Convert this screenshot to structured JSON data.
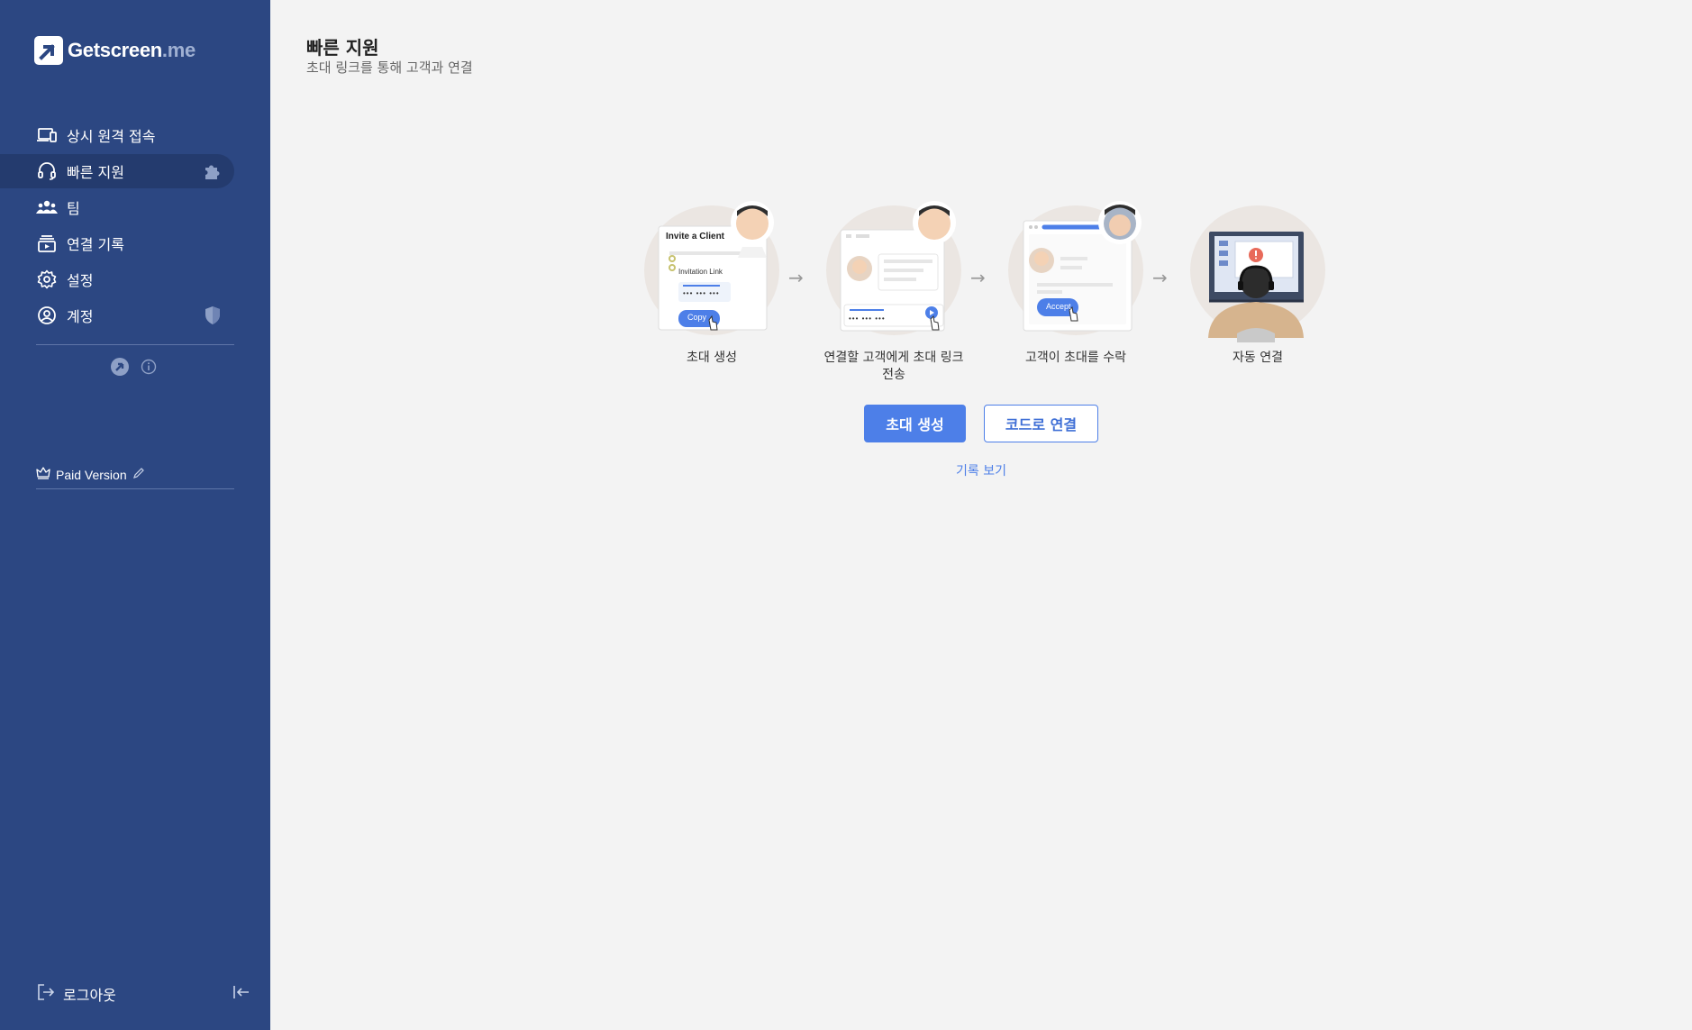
{
  "app": {
    "logo_main": "Getscreen",
    "logo_suffix": ".me"
  },
  "sidebar": {
    "items": [
      {
        "label": "상시 원격 접속",
        "icon": "devices-icon"
      },
      {
        "label": "빠른 지원",
        "icon": "headset-icon",
        "active": true,
        "extra_icon": "puzzle-icon"
      },
      {
        "label": "팀",
        "icon": "team-icon"
      },
      {
        "label": "연결 기록",
        "icon": "history-icon"
      },
      {
        "label": "설정",
        "icon": "gear-icon"
      },
      {
        "label": "계정",
        "icon": "user-circle-icon",
        "extra_icon": "shield-icon"
      }
    ],
    "plan": "Paid Version",
    "logout": "로그아웃"
  },
  "main": {
    "title": "빠른 지원",
    "subtitle": "초대 링크를 통해 고객과 연결",
    "steps": [
      {
        "label": "초대 생성",
        "art_title": "Invite a Client",
        "art_link": "Invitation Link",
        "art_dots": "••• ••• •••",
        "art_button": "Copy"
      },
      {
        "label": "연결할 고객에게 초대 링크 전송",
        "art_dots": "••• ••• •••"
      },
      {
        "label": "고객이 초대를 수락",
        "art_button": "Accept"
      },
      {
        "label": "자동 연결"
      }
    ],
    "primary_button": "초대 생성",
    "secondary_button": "코드로 연결",
    "history_link": "기록 보기"
  },
  "colors": {
    "sidebar_bg": "#2c4782",
    "sidebar_active": "#243b6e",
    "accent": "#4d7fe8",
    "page_bg": "#f3f3f3"
  }
}
